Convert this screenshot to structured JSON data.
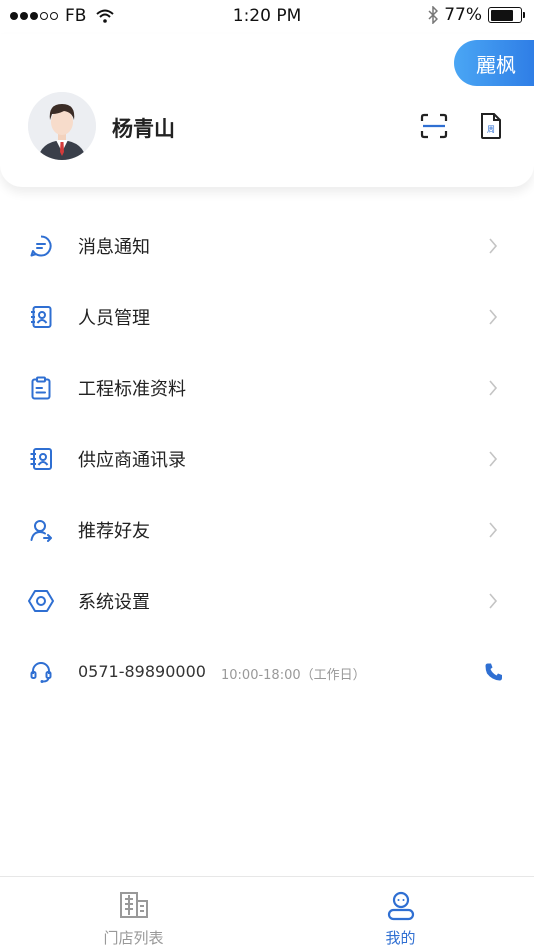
{
  "status_bar": {
    "carrier": "FB",
    "time": "1:20 PM",
    "battery_percent": "77%",
    "battery_level": 0.77,
    "signal_icons": [
      "signal-dots-icon",
      "wifi-icon",
      "bluetooth-icon",
      "battery-icon"
    ]
  },
  "header": {
    "brand_label": "麗枫",
    "user_name": "杨青山",
    "brand_color": "#3b8ff0",
    "actions": [
      "scan-icon",
      "document-icon"
    ],
    "doc_icon_text": "周"
  },
  "menu": {
    "items": [
      {
        "label": "消息通知",
        "icon": "message-icon"
      },
      {
        "label": "人员管理",
        "icon": "staff-contact-icon"
      },
      {
        "label": "工程标准资料",
        "icon": "clipboard-icon"
      },
      {
        "label": "供应商通讯录",
        "icon": "supplier-contacts-icon"
      },
      {
        "label": "推荐好友",
        "icon": "user-recommend-icon"
      },
      {
        "label": "系统设置",
        "icon": "settings-hex-icon"
      }
    ],
    "hotline": {
      "number": "0571-89890000",
      "hours": "10:00-18:00（工作日）",
      "icon": "headset-icon",
      "call_icon": "phone-icon"
    },
    "icon_color": "#2f6fd2"
  },
  "tab_bar": {
    "tabs": [
      {
        "label": "门店列表",
        "icon": "building-icon",
        "active": false
      },
      {
        "label": "我的",
        "icon": "profile-icon",
        "active": true
      }
    ],
    "active_color": "#2f6fd2",
    "inactive_color": "#999999"
  }
}
